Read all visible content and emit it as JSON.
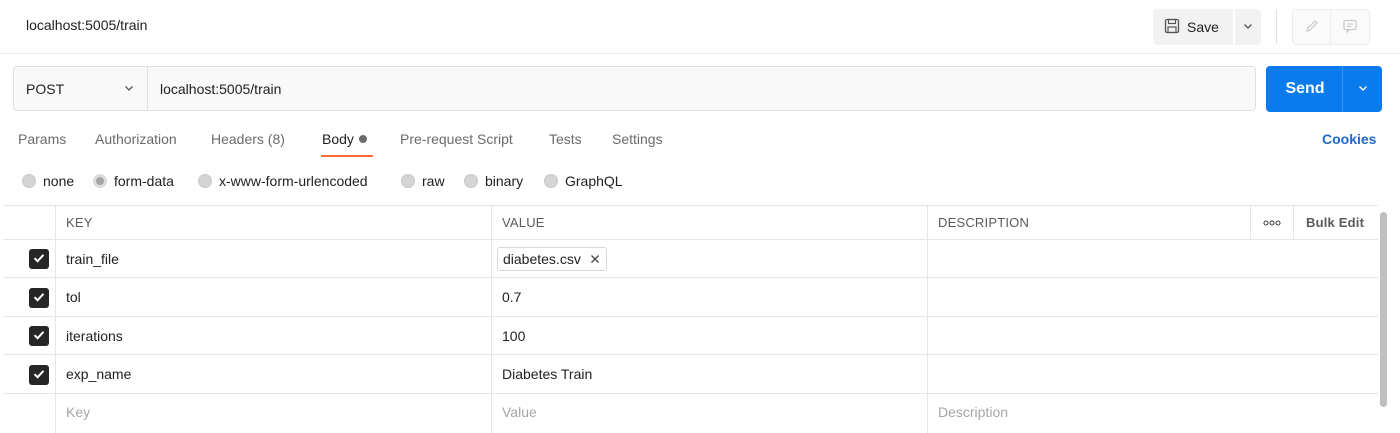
{
  "header": {
    "tab_title": "localhost:5005/train",
    "save_label": "Save"
  },
  "request": {
    "method": "POST",
    "url": "localhost:5005/train",
    "send_label": "Send"
  },
  "tabs": [
    {
      "label": "Params"
    },
    {
      "label": "Authorization"
    },
    {
      "label": "Headers (8)"
    },
    {
      "label": "Body"
    },
    {
      "label": "Pre-request Script"
    },
    {
      "label": "Tests"
    },
    {
      "label": "Settings"
    }
  ],
  "active_tab": "Body",
  "cookies_label": "Cookies",
  "body_types": [
    {
      "label": "none",
      "selected": false
    },
    {
      "label": "form-data",
      "selected": true
    },
    {
      "label": "x-www-form-urlencoded",
      "selected": false
    },
    {
      "label": "raw",
      "selected": false
    },
    {
      "label": "binary",
      "selected": false
    },
    {
      "label": "GraphQL",
      "selected": false
    }
  ],
  "table": {
    "headers": {
      "key": "KEY",
      "value": "VALUE",
      "description": "DESCRIPTION",
      "bulk_edit": "Bulk Edit"
    },
    "rows": [
      {
        "checked": true,
        "key": "train_file",
        "value": "diabetes.csv",
        "value_type": "file",
        "description": ""
      },
      {
        "checked": true,
        "key": "tol",
        "value": "0.7",
        "value_type": "text",
        "description": ""
      },
      {
        "checked": true,
        "key": "iterations",
        "value": "100",
        "value_type": "text",
        "description": ""
      },
      {
        "checked": true,
        "key": "exp_name",
        "value": "Diabetes Train",
        "value_type": "text",
        "description": ""
      }
    ],
    "placeholders": {
      "key": "Key",
      "value": "Value",
      "description": "Description"
    }
  },
  "colors": {
    "send_button": "#097bed",
    "cookies_link": "#1d6ac6",
    "active_tab_underline": "#ff6c37"
  }
}
